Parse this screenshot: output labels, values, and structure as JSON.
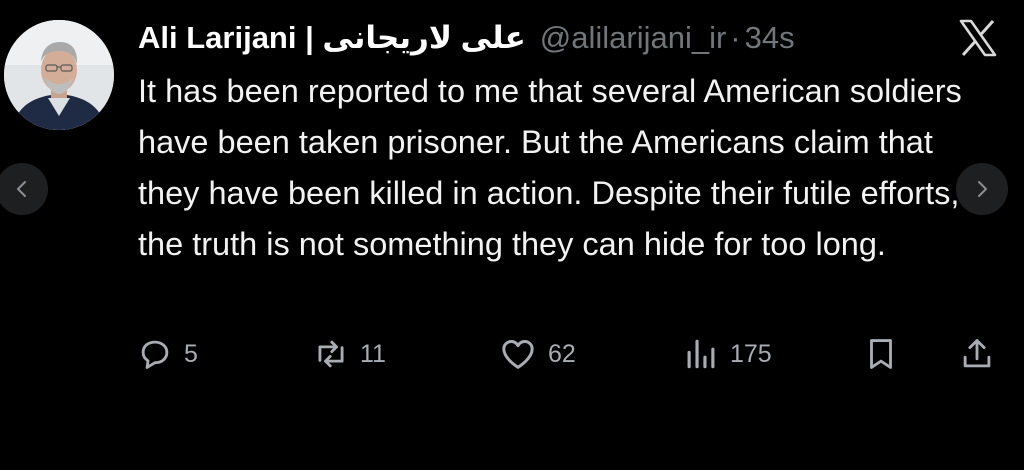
{
  "author": {
    "name": "Ali Larijani | علی لاریجانی",
    "handle": "@alilarijani_ir",
    "separator": "·",
    "time": "34s"
  },
  "tweet": {
    "text": "It has been reported to me that several American soldiers have been taken prisoner. But the Americans claim that they have been killed in action. Despite their futile efforts, the truth is not something they can hide for too long."
  },
  "actions": {
    "replies": "5",
    "reposts": "11",
    "likes": "62",
    "views": "175"
  },
  "icons": {
    "logo": "x-logo-icon",
    "reply": "reply-icon",
    "repost": "repost-icon",
    "like": "heart-icon",
    "views": "views-icon",
    "bookmark": "bookmark-icon",
    "share": "share-icon",
    "prev": "chevron-left-icon",
    "next": "chevron-right-icon"
  },
  "colors": {
    "background": "#000000",
    "text": "#e7e9ea",
    "secondary": "#71767b",
    "action": "#a8adb3",
    "nav_button": "#1e1f20"
  }
}
